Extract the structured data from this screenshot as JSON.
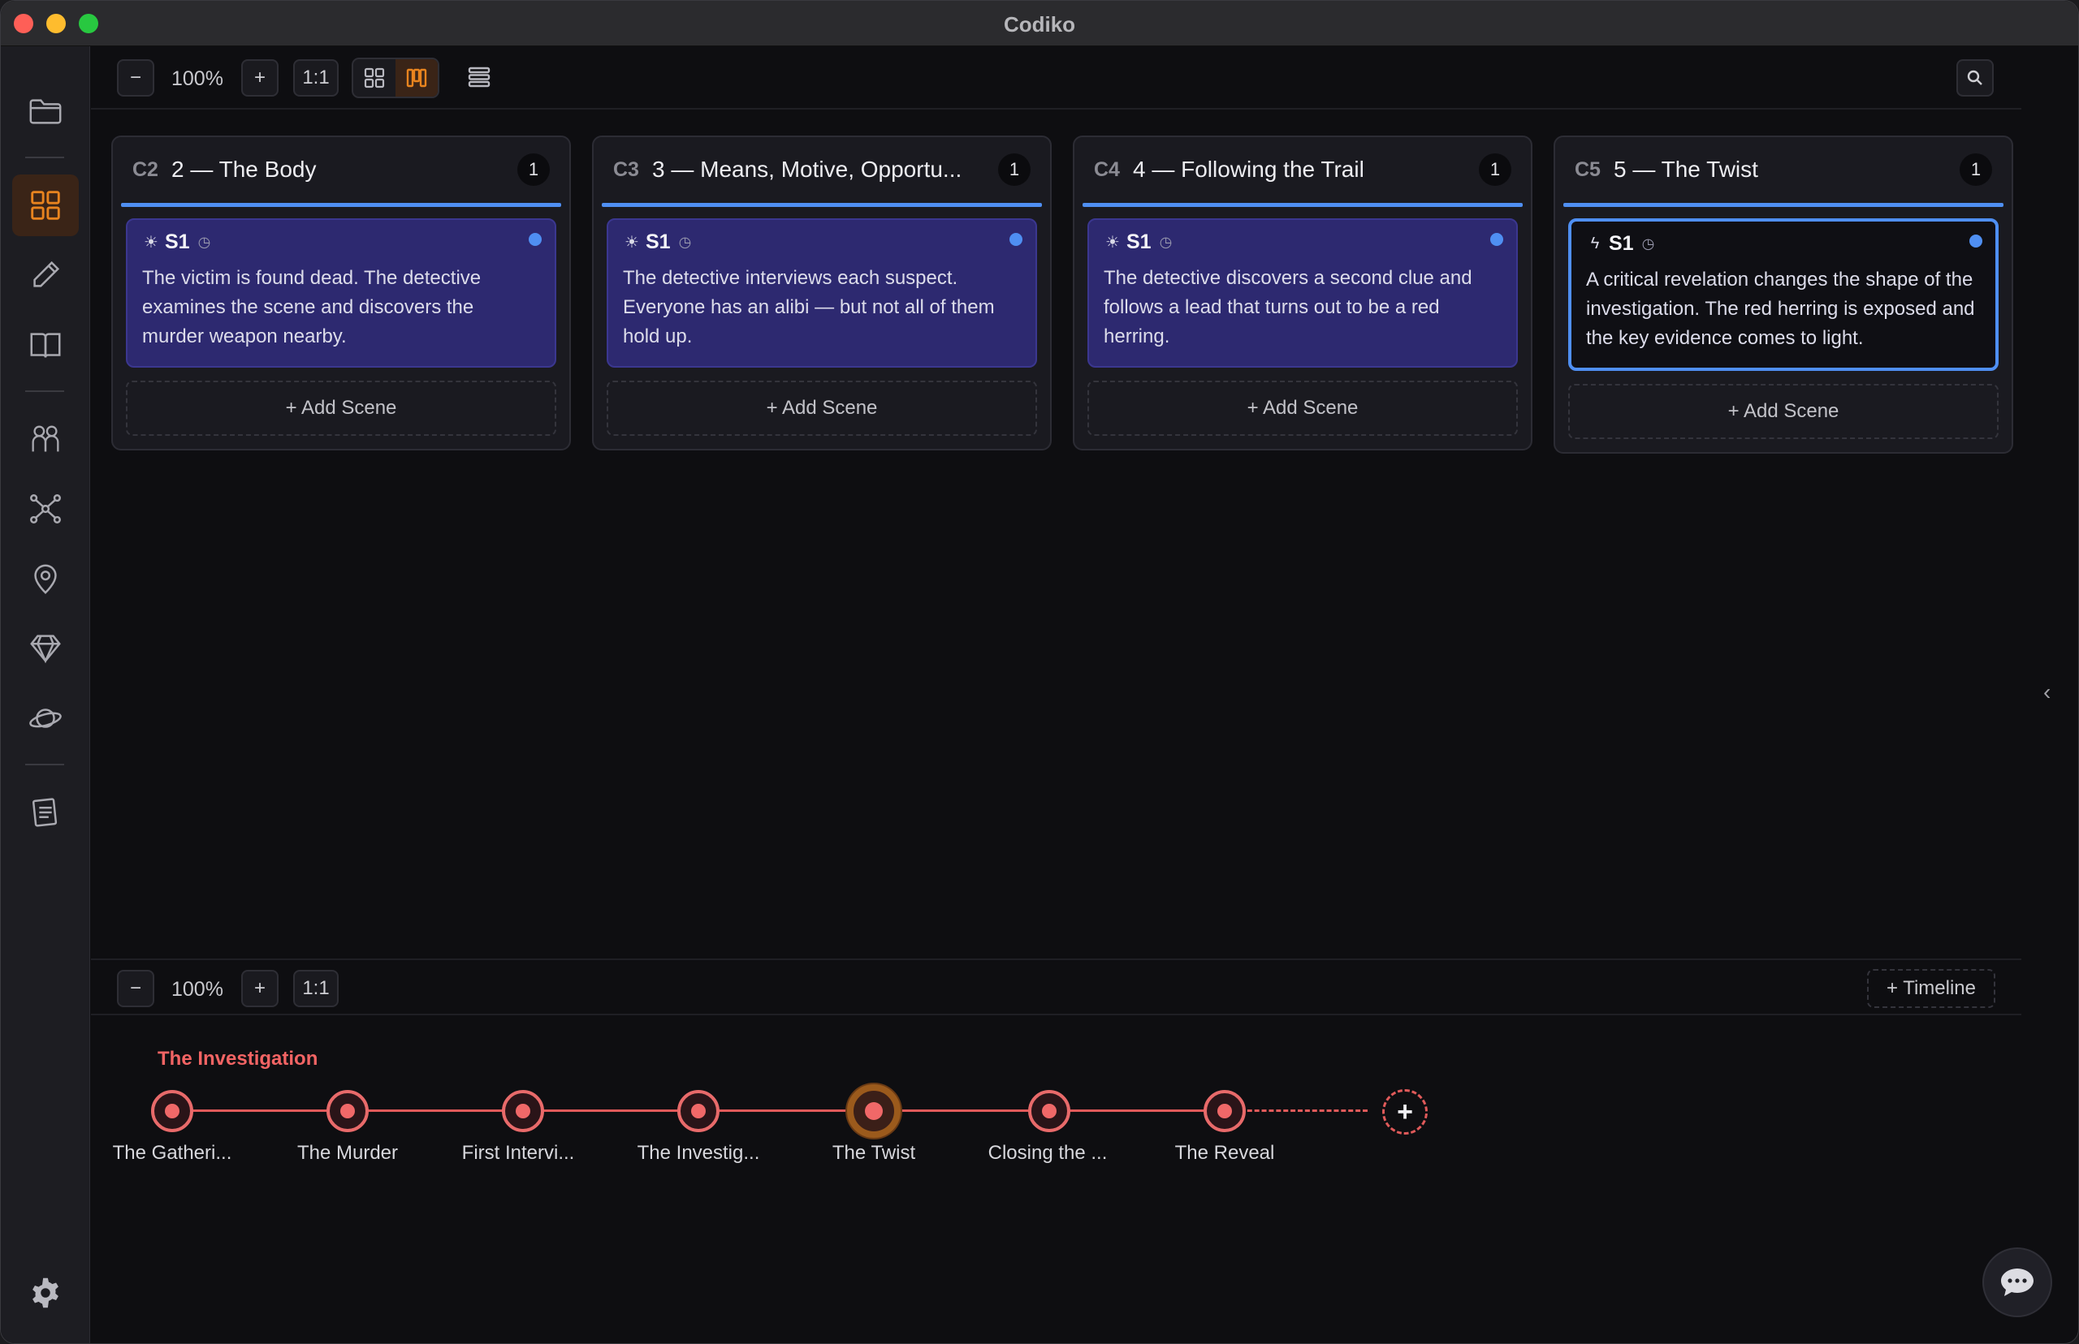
{
  "window": {
    "title": "Codiko"
  },
  "colors": {
    "accent": "#4f8ff2",
    "timeline": "#f26464",
    "active_nav": "#e8841f"
  },
  "sidebar": {
    "items": [
      {
        "icon": "folder-icon"
      },
      {
        "icon": "board-grid-icon",
        "active": true
      },
      {
        "icon": "pencil-icon"
      },
      {
        "icon": "book-icon"
      },
      {
        "icon": "characters-icon"
      },
      {
        "icon": "network-graph-icon"
      },
      {
        "icon": "location-pin-icon"
      },
      {
        "icon": "gem-icon"
      },
      {
        "icon": "planet-icon"
      },
      {
        "icon": "notes-icon"
      }
    ],
    "settings_icon": "gear-icon"
  },
  "toolbar": {
    "zoom_out": "−",
    "zoom_level": "100%",
    "zoom_in": "+",
    "reset_zoom": "1:1",
    "views": [
      "grid-view-icon",
      "columns-view-icon",
      "list-view-icon"
    ],
    "active_view": "columns-view-icon",
    "search_icon": "search-icon"
  },
  "board": {
    "columns": [
      {
        "code": "C2",
        "title": "2 — The Body",
        "count": "1",
        "scenes": [
          {
            "icon": "☀",
            "id": "S1",
            "text": "The victim is found dead. The detective examines the scene and discovers the murder weapon nearby."
          }
        ],
        "add_label": "+ Add Scene"
      },
      {
        "code": "C3",
        "title": "3 — Means, Motive, Opportu...",
        "count": "1",
        "scenes": [
          {
            "icon": "☀",
            "id": "S1",
            "text": "The detective interviews each suspect. Everyone has an alibi — but not all of them hold up."
          }
        ],
        "add_label": "+ Add Scene"
      },
      {
        "code": "C4",
        "title": "4 — Following the Trail",
        "count": "1",
        "scenes": [
          {
            "icon": "☀",
            "id": "S1",
            "text": "The detective discovers a second clue and follows a lead that turns out to be a red herring."
          }
        ],
        "add_label": "+ Add Scene"
      },
      {
        "code": "C5",
        "title": "5 — The Twist",
        "count": "1",
        "scenes": [
          {
            "icon": "ϟ",
            "id": "S1",
            "text": "A critical revelation changes the shape of the investigation. The red herring is exposed and the key evidence comes to light.",
            "selected": true
          }
        ],
        "add_label": "+ Add Scene"
      }
    ],
    "collapse_icon": "chevron-left-icon"
  },
  "timeline": {
    "toolbar": {
      "zoom_out": "−",
      "zoom_level": "100%",
      "zoom_in": "+",
      "reset_zoom": "1:1",
      "add_label": "+ Timeline"
    },
    "name": "The Investigation",
    "events": [
      {
        "label": "The Gatheri..."
      },
      {
        "label": "The Murder"
      },
      {
        "label": "First Intervi..."
      },
      {
        "label": "The Investig..."
      },
      {
        "label": "The Twist",
        "current": true
      },
      {
        "label": "Closing the ..."
      },
      {
        "label": "The Reveal"
      }
    ],
    "add_event": "+"
  },
  "chat_icon": "chat-bubble-icon"
}
